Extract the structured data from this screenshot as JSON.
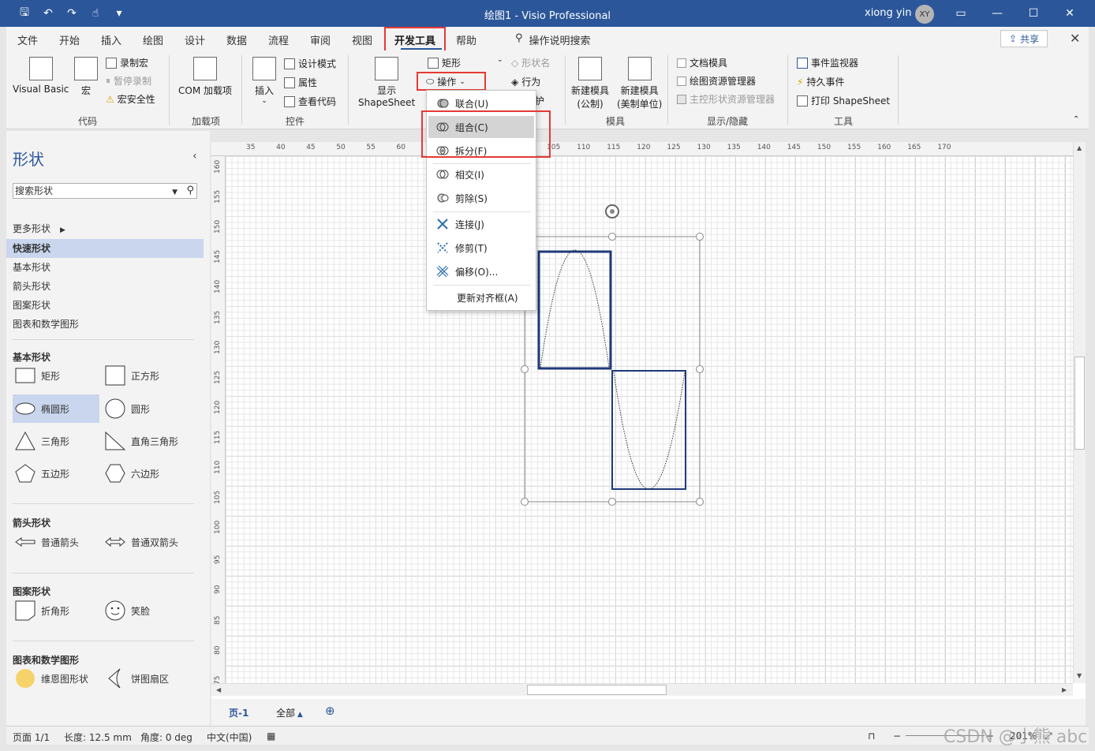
{
  "titlebar": {
    "title": "绘图1  -  Visio Professional",
    "user_name": "xiong yin",
    "avatar_initials": "XY"
  },
  "menu": {
    "tabs": [
      "文件",
      "开始",
      "插入",
      "绘图",
      "设计",
      "数据",
      "流程",
      "审阅",
      "视图",
      "开发工具",
      "帮助"
    ],
    "active_tab": "开发工具",
    "search_label": "操作说明搜索",
    "share_label": "共享"
  },
  "ribbon": {
    "code": {
      "label": "代码",
      "visual_basic": "Visual Basic",
      "macro": "宏",
      "record_macro": "录制宏",
      "pause_record": "暂停录制",
      "macro_security": "宏安全性"
    },
    "addins": {
      "label": "加载项",
      "com_addins": "COM 加载项"
    },
    "controls": {
      "label": "控件",
      "insert": "插入",
      "design_mode": "设计模式",
      "properties": "属性",
      "view_code": "查看代码"
    },
    "shape_design": {
      "show_shapesheet_line1": "显示",
      "show_shapesheet_line2": "ShapeSheet",
      "rectangle": "矩形",
      "operations": "操作",
      "shape_name": "形状名",
      "behavior": "行为",
      "protect_partial": "护"
    },
    "stencil": {
      "label": "模具",
      "new_metric_line1": "新建模具",
      "new_metric_line2": "(公制)",
      "new_us_line1": "新建模具",
      "new_us_line2": "(美制单位)"
    },
    "show_hide": {
      "label": "显示/隐藏",
      "document_stencil": "文档模具",
      "drawing_explorer": "绘图资源管理器",
      "master_explorer": "主控形状资源管理器"
    },
    "tools": {
      "label": "工具",
      "event_monitor": "事件监视器",
      "persistent_events": "持久事件",
      "print_shapesheet": "打印 ShapeSheet"
    }
  },
  "operations_menu": [
    {
      "label": "联合(U)",
      "icon": "union-icon"
    },
    {
      "label": "组合(C)",
      "icon": "combine-icon"
    },
    {
      "label": "拆分(F)",
      "icon": "fragment-icon"
    },
    {
      "label": "相交(I)",
      "icon": "intersect-icon"
    },
    {
      "label": "剪除(S)",
      "icon": "subtract-icon"
    },
    {
      "label": "连接(J)",
      "icon": "join-icon"
    },
    {
      "label": "修剪(T)",
      "icon": "trim-icon"
    },
    {
      "label": "偏移(O)...",
      "icon": "offset-icon"
    },
    {
      "label": "更新对齐框(A)",
      "icon": ""
    }
  ],
  "shapes_panel": {
    "title": "形状",
    "search_placeholder": "搜索形状",
    "more_shapes": "更多形状",
    "nav": [
      "快速形状",
      "基本形状",
      "箭头形状",
      "图案形状",
      "图表和数学图形"
    ],
    "sections": [
      {
        "title": "基本形状",
        "items": [
          "矩形",
          "正方形",
          "椭圆形",
          "圆形",
          "三角形",
          "直角三角形",
          "五边形",
          "六边形"
        ]
      },
      {
        "title": "箭头形状",
        "items": [
          "普通箭头",
          "普通双箭头"
        ]
      },
      {
        "title": "图案形状",
        "items": [
          "折角形",
          "笑脸"
        ]
      },
      {
        "title": "图表和数学图形",
        "items": [
          "维恩图形状",
          "饼图扇区"
        ]
      }
    ]
  },
  "ruler": {
    "top": [
      "35",
      "40",
      "45",
      "50",
      "55",
      "60",
      "85",
      "90",
      "95",
      "100",
      "105",
      "110",
      "115",
      "120",
      "125",
      "130",
      "135",
      "140",
      "145",
      "150",
      "155",
      "160",
      "165",
      "170"
    ],
    "left": [
      "160",
      "155",
      "150",
      "145",
      "140",
      "135",
      "130",
      "125",
      "120",
      "115",
      "110",
      "105",
      "100",
      "95",
      "90",
      "85",
      "80",
      "75"
    ]
  },
  "page_tabs": {
    "page": "页-1",
    "all": "全部"
  },
  "status": {
    "page": "页面 1/1",
    "length": "长度: 12.5 mm",
    "angle": "角度: 0 deg",
    "language": "中文(中国)",
    "zoom": "201%"
  },
  "watermark": "CSDN @小熊 abc",
  "colors": {
    "brand": "#2b579a",
    "highlight_box": "#e53935",
    "shape_stroke": "#1f3a7a"
  }
}
